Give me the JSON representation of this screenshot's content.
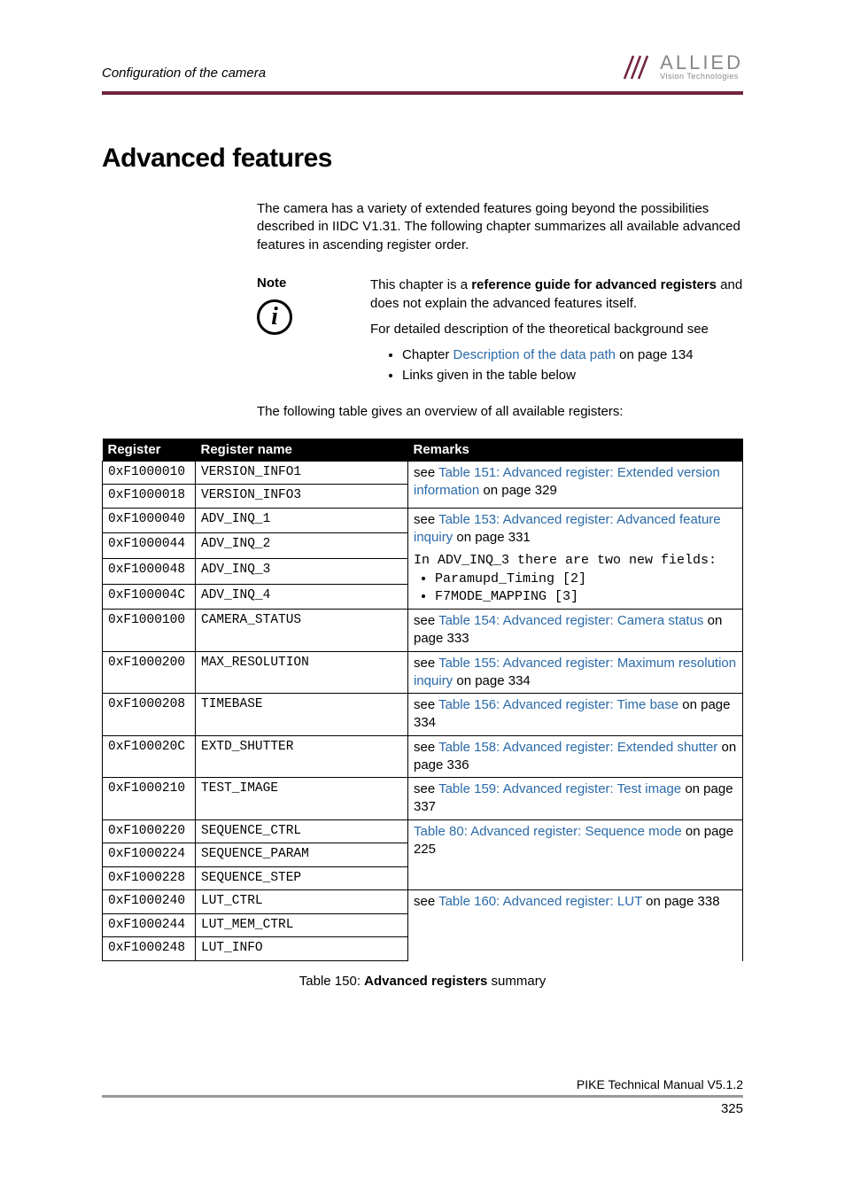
{
  "section_header": "Configuration of the camera",
  "logo": {
    "main": "ALLIED",
    "sub": "Vision Technologies"
  },
  "title": "Advanced features",
  "intro": "The camera has a variety of extended features going beyond the possibilities described in IIDC V1.31. The following chapter summarizes all available advanced features in ascending register order.",
  "note": {
    "label": "Note",
    "line1a": "This chapter is a ",
    "line1b": "reference guide for advanced registers",
    "line1c": " and does not explain the advanced features itself.",
    "line2": "For detailed description of the theoretical background see",
    "bullet1a": "Chapter ",
    "bullet1b": "Description of the data path",
    "bullet1c": " on page 134",
    "bullet2": "Links given in the table below"
  },
  "overview_line": "The following table gives an overview of all available registers:",
  "table": {
    "headers": {
      "register": "Register",
      "name": "Register name",
      "remarks": "Remarks"
    },
    "rows": [
      {
        "reg": "0xF1000010",
        "name": "VERSION_INFO1"
      },
      {
        "reg": "0xF1000018",
        "name": "VERSION_INFO3"
      },
      {
        "reg": "0xF1000040",
        "name": "ADV_INQ_1"
      },
      {
        "reg": "0xF1000044",
        "name": "ADV_INQ_2"
      },
      {
        "reg": "0xF1000048",
        "name": "ADV_INQ_3"
      },
      {
        "reg": "0xF100004C",
        "name": "ADV_INQ_4"
      },
      {
        "reg": "0xF1000100",
        "name": "CAMERA_STATUS"
      },
      {
        "reg": "0xF1000200",
        "name": "MAX_RESOLUTION"
      },
      {
        "reg": "0xF1000208",
        "name": "TIMEBASE"
      },
      {
        "reg": "0xF100020C",
        "name": "EXTD_SHUTTER"
      },
      {
        "reg": "0xF1000210",
        "name": "TEST_IMAGE"
      },
      {
        "reg": "0xF1000220",
        "name": "SEQUENCE_CTRL"
      },
      {
        "reg": "0xF1000224",
        "name": "SEQUENCE_PARAM"
      },
      {
        "reg": "0xF1000228",
        "name": "SEQUENCE_STEP"
      },
      {
        "reg": "0xF1000240",
        "name": "LUT_CTRL"
      },
      {
        "reg": "0xF1000244",
        "name": "LUT_MEM_CTRL"
      },
      {
        "reg": "0xF1000248",
        "name": "LUT_INFO"
      }
    ],
    "remarks": {
      "version_a": "see ",
      "version_link": "Table 151: Advanced register: Extended version information",
      "version_b": " on page 329",
      "advinq_a": "see ",
      "advinq_link": "Table 153: Advanced register: Advanced feature inquiry",
      "advinq_b": " on page 331",
      "advinq3_line": "In ADV_INQ_3 there are two new fields:",
      "advinq3_b1": "Paramupd_Timing [2]",
      "advinq3_b2": "F7MODE_MAPPING [3]",
      "camstatus_a": "see ",
      "camstatus_link": "Table 154: Advanced register: Camera status",
      "camstatus_b": " on page 333",
      "maxres_a": "see ",
      "maxres_link": "Table 155: Advanced register: Maximum resolution inquiry",
      "maxres_b": " on page 334",
      "timebase_a": "see ",
      "timebase_link": "Table 156: Advanced register: Time base",
      "timebase_b": " on page 334",
      "extd_a": "see ",
      "extd_link": "Table 158: Advanced register: Extended shutter",
      "extd_b": " on page 336",
      "test_a": "see ",
      "test_link": "Table 159: Advanced register: Test image",
      "test_b": " on page 337",
      "seq_link": "Table 80: Advanced register: Sequence mode",
      "seq_b": " on page 225",
      "lut_a": "see ",
      "lut_link": "Table 160: Advanced register: LUT",
      "lut_b": " on page 338"
    }
  },
  "caption_a": "Table 150: ",
  "caption_b": "Advanced registers",
  "caption_c": " summary",
  "footer_title": "PIKE Technical Manual V5.1.2",
  "page_number": "325"
}
